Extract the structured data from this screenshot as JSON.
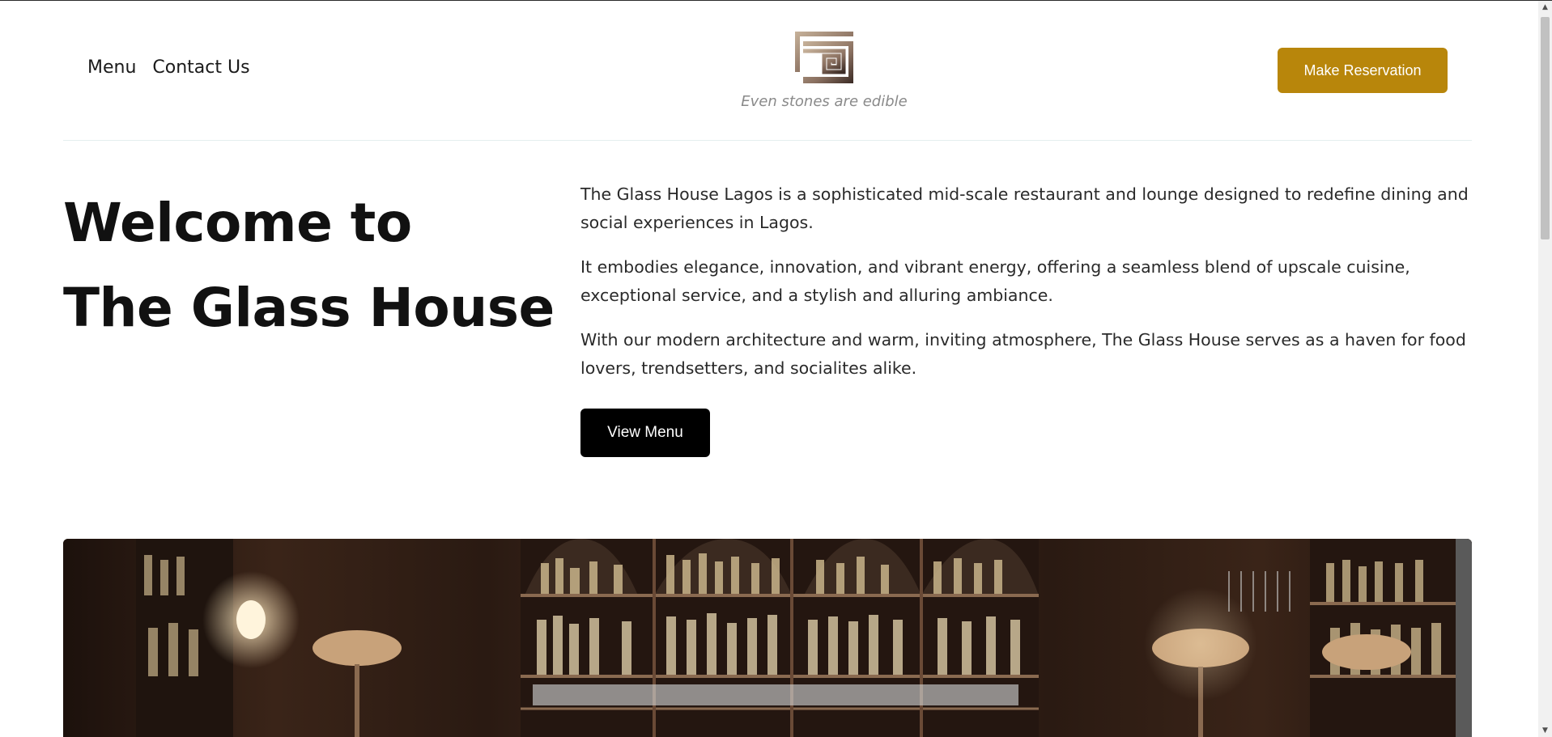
{
  "nav": {
    "items": [
      {
        "label": "Menu"
      },
      {
        "label": "Contact Us"
      }
    ]
  },
  "logo": {
    "icon": "glass-house-logo-icon",
    "tagline": "Even stones are edible"
  },
  "header": {
    "reserve_label": "Make Reservation"
  },
  "hero": {
    "title_line1": "Welcome to",
    "title_line2": "The Glass House",
    "paragraphs": [
      "The Glass House Lagos is a sophisticated mid-scale restaurant and lounge designed to redefine dining and social experiences in Lagos.",
      "It embodies elegance, innovation, and vibrant energy, offering a seamless blend of upscale cuisine, exceptional service, and a stylish and alluring ambiance.",
      "With our modern architecture and warm, inviting atmosphere, The Glass House serves as a haven for food lovers, trendsetters, and socialites alike."
    ],
    "view_menu_label": "View Menu"
  },
  "colors": {
    "accent": "#b8860b",
    "primary_button": "#000000",
    "text": "#111111"
  },
  "scrollbar": {
    "up_icon": "scroll-up-arrow-icon",
    "down_icon": "scroll-down-arrow-icon"
  }
}
